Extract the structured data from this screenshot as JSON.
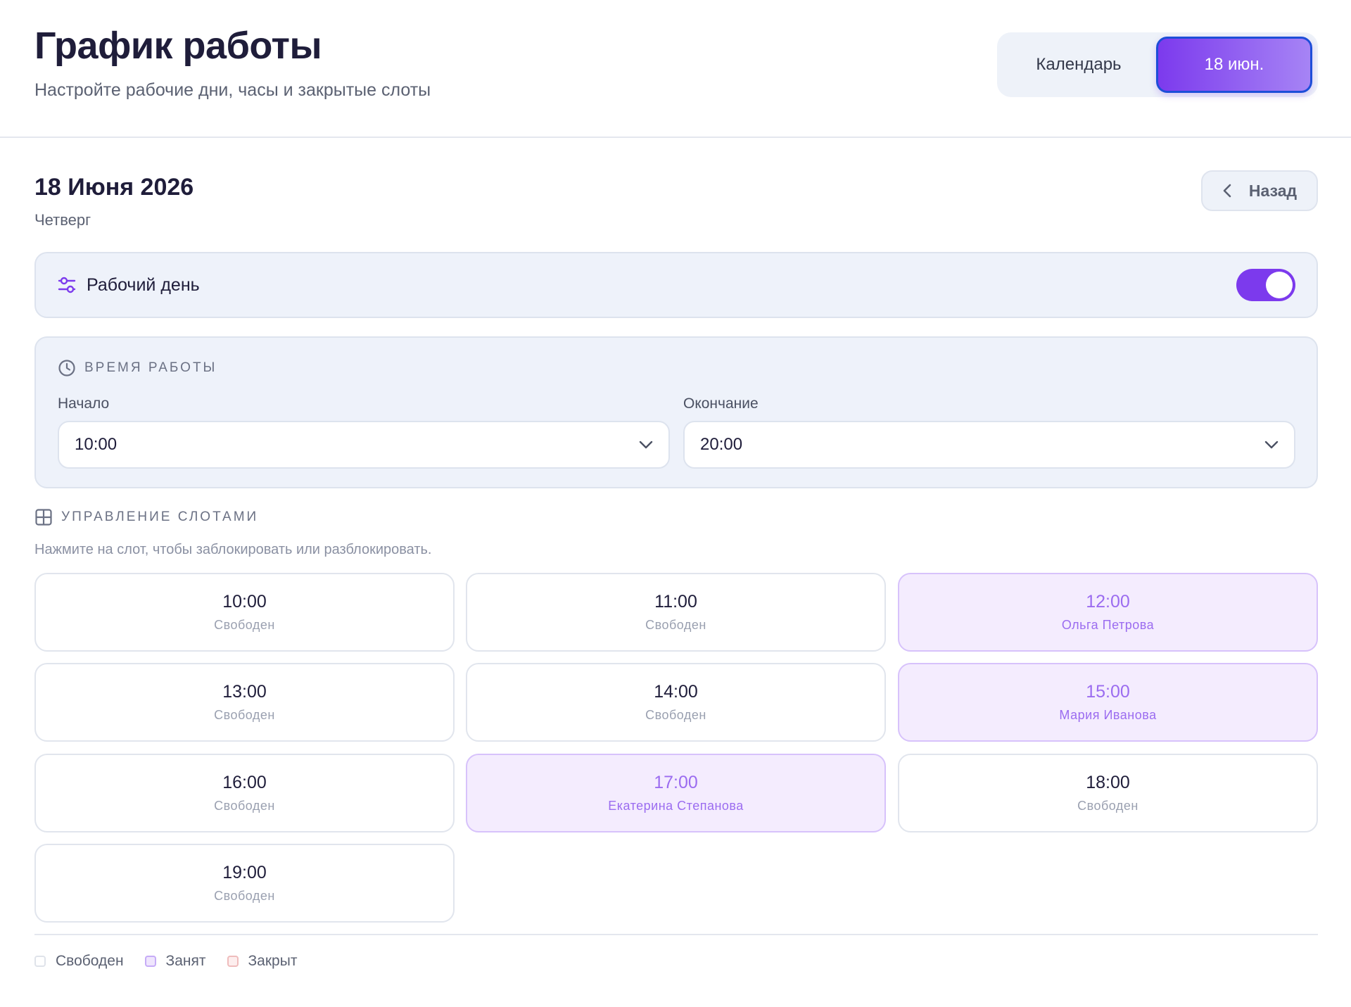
{
  "header": {
    "title": "График работы",
    "subtitle": "Настройте рабочие дни, часы и закрытые слоты",
    "view_switch": {
      "calendar_label": "Календарь",
      "date_label": "18 июн."
    }
  },
  "day": {
    "date_title": "18 Июня 2026",
    "weekday": "Четверг",
    "back_label": "Назад"
  },
  "workday": {
    "label": "Рабочий день",
    "enabled": true
  },
  "hours": {
    "section_title": "ВРЕМЯ РАБОТЫ",
    "start_label": "Начало",
    "start_value": "10:00",
    "end_label": "Окончание",
    "end_value": "20:00"
  },
  "slots_section": {
    "title": "УПРАВЛЕНИЕ СЛОТАМИ",
    "hint": "Нажмите на слот, чтобы заблокировать или разблокировать."
  },
  "slots": [
    {
      "time": "10:00",
      "status": "Свободен",
      "state": "free"
    },
    {
      "time": "11:00",
      "status": "Свободен",
      "state": "free"
    },
    {
      "time": "12:00",
      "status": "Ольга Петрова",
      "state": "booked"
    },
    {
      "time": "13:00",
      "status": "Свободен",
      "state": "free"
    },
    {
      "time": "14:00",
      "status": "Свободен",
      "state": "free"
    },
    {
      "time": "15:00",
      "status": "Мария Иванова",
      "state": "booked"
    },
    {
      "time": "16:00",
      "status": "Свободен",
      "state": "free"
    },
    {
      "time": "17:00",
      "status": "Екатерина Степанова",
      "state": "booked"
    },
    {
      "time": "18:00",
      "status": "Свободен",
      "state": "free"
    },
    {
      "time": "19:00",
      "status": "Свободен",
      "state": "free"
    }
  ],
  "legend": {
    "free": "Свободен",
    "booked": "Занят",
    "closed": "Закрыт"
  },
  "colors": {
    "accent": "#7c3aed",
    "booked_bg": "#f4ecfe",
    "booked_text": "#9b6cf0",
    "closed": "#efbcbc"
  },
  "icons": {
    "workday": "sliders-icon",
    "hours": "clock-icon",
    "slots": "grid-icon",
    "back": "chevron-left-icon",
    "select": "chevron-down-icon"
  }
}
